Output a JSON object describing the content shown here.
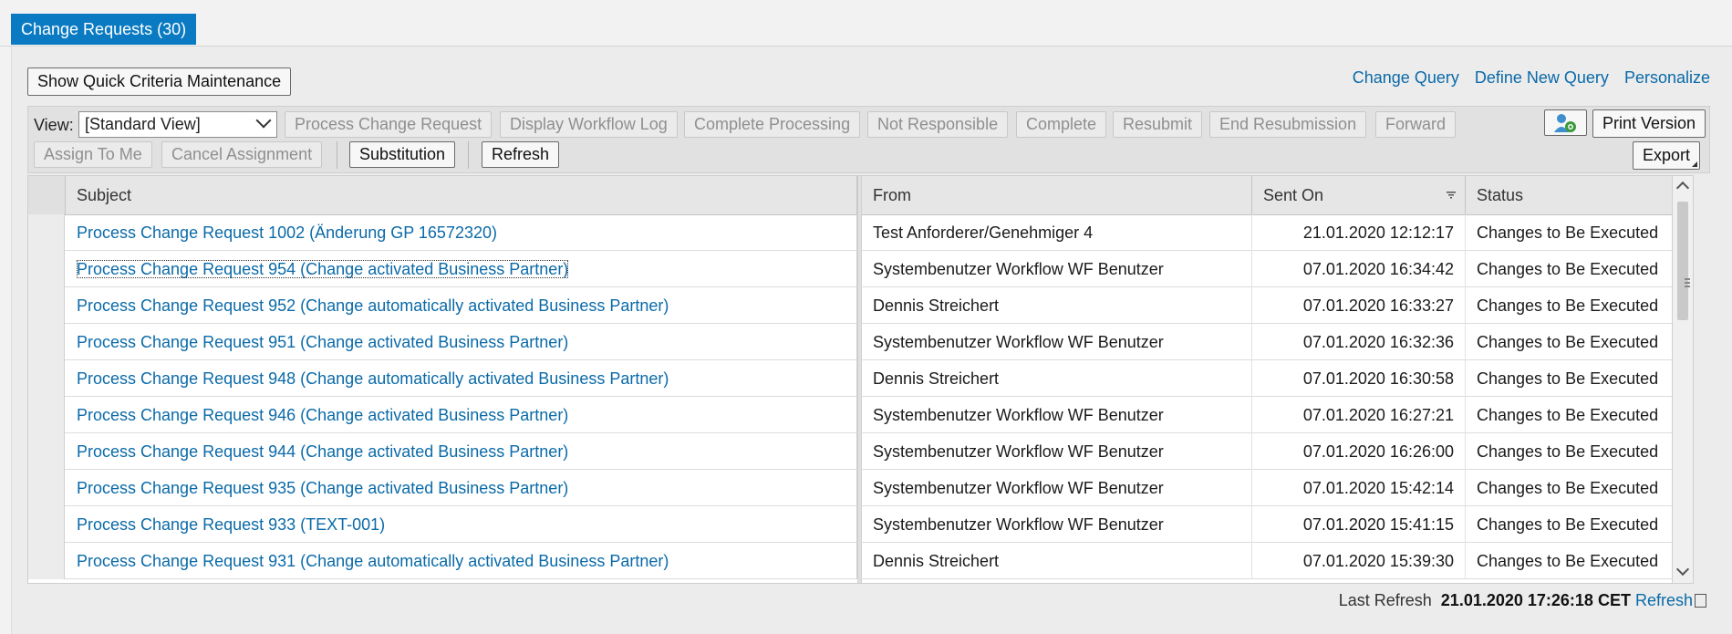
{
  "tab": {
    "label": "Change Requests (30)"
  },
  "quick_criteria_button": "Show Quick Criteria Maintenance",
  "top_links": [
    "Change Query",
    "Define New Query",
    "Personalize"
  ],
  "toolbar": {
    "view_label": "View:",
    "view_value": "[Standard View]",
    "buttons_row1": [
      "Process Change Request",
      "Display Workflow Log",
      "Complete Processing",
      "Not Responsible",
      "Complete",
      "Resubmit",
      "End Resubmission",
      "Forward"
    ],
    "buttons_row2_disabled": [
      "Assign To Me",
      "Cancel Assignment"
    ],
    "substitution": "Substitution",
    "refresh": "Refresh",
    "print_version": "Print Version",
    "export": "Export"
  },
  "columns": [
    "Subject",
    "From",
    "Sent On",
    "Status"
  ],
  "rows": [
    {
      "subject": "Process Change Request 1002 (Änderung GP 16572320)",
      "from": "Test Anforderer/Genehmiger 4",
      "sent": "21.01.2020 12:12:17",
      "status": "Changes to Be Executed"
    },
    {
      "subject": "Process Change Request 954 (Change activated Business Partner)",
      "from": "Systembenutzer Workflow WF Benutzer",
      "sent": "07.01.2020 16:34:42",
      "status": "Changes to Be Executed"
    },
    {
      "subject": "Process Change Request 952 (Change automatically activated Business Partner)",
      "from": "Dennis Streichert",
      "sent": "07.01.2020 16:33:27",
      "status": "Changes to Be Executed"
    },
    {
      "subject": "Process Change Request 951 (Change activated Business Partner)",
      "from": "Systembenutzer Workflow WF Benutzer",
      "sent": "07.01.2020 16:32:36",
      "status": "Changes to Be Executed"
    },
    {
      "subject": "Process Change Request 948 (Change automatically activated Business Partner)",
      "from": "Dennis Streichert",
      "sent": "07.01.2020 16:30:58",
      "status": "Changes to Be Executed"
    },
    {
      "subject": "Process Change Request 946 (Change activated Business Partner)",
      "from": "Systembenutzer Workflow WF Benutzer",
      "sent": "07.01.2020 16:27:21",
      "status": "Changes to Be Executed"
    },
    {
      "subject": "Process Change Request 944 (Change activated Business Partner)",
      "from": "Systembenutzer Workflow WF Benutzer",
      "sent": "07.01.2020 16:26:00",
      "status": "Changes to Be Executed"
    },
    {
      "subject": "Process Change Request 935 (Change activated Business Partner)",
      "from": "Systembenutzer Workflow WF Benutzer",
      "sent": "07.01.2020 15:42:14",
      "status": "Changes to Be Executed"
    },
    {
      "subject": "Process Change Request 933 (TEXT-001)",
      "from": "Systembenutzer Workflow WF Benutzer",
      "sent": "07.01.2020 15:41:15",
      "status": "Changes to Be Executed"
    },
    {
      "subject": "Process Change Request 931 (Change automatically activated Business Partner)",
      "from": "Dennis Streichert",
      "sent": "07.01.2020 15:39:30",
      "status": "Changes to Be Executed"
    }
  ],
  "footer": {
    "last_refresh_label": "Last Refresh",
    "last_refresh_value": "21.01.2020 17:26:18 CET",
    "refresh_link": "Refresh"
  },
  "colors": {
    "accent": "#0a7ac2",
    "link": "#0a6aa8"
  },
  "icons": [
    "settings-user-icon",
    "sort-filter-icon",
    "export-corner-icon",
    "refresh-page-icon"
  ]
}
